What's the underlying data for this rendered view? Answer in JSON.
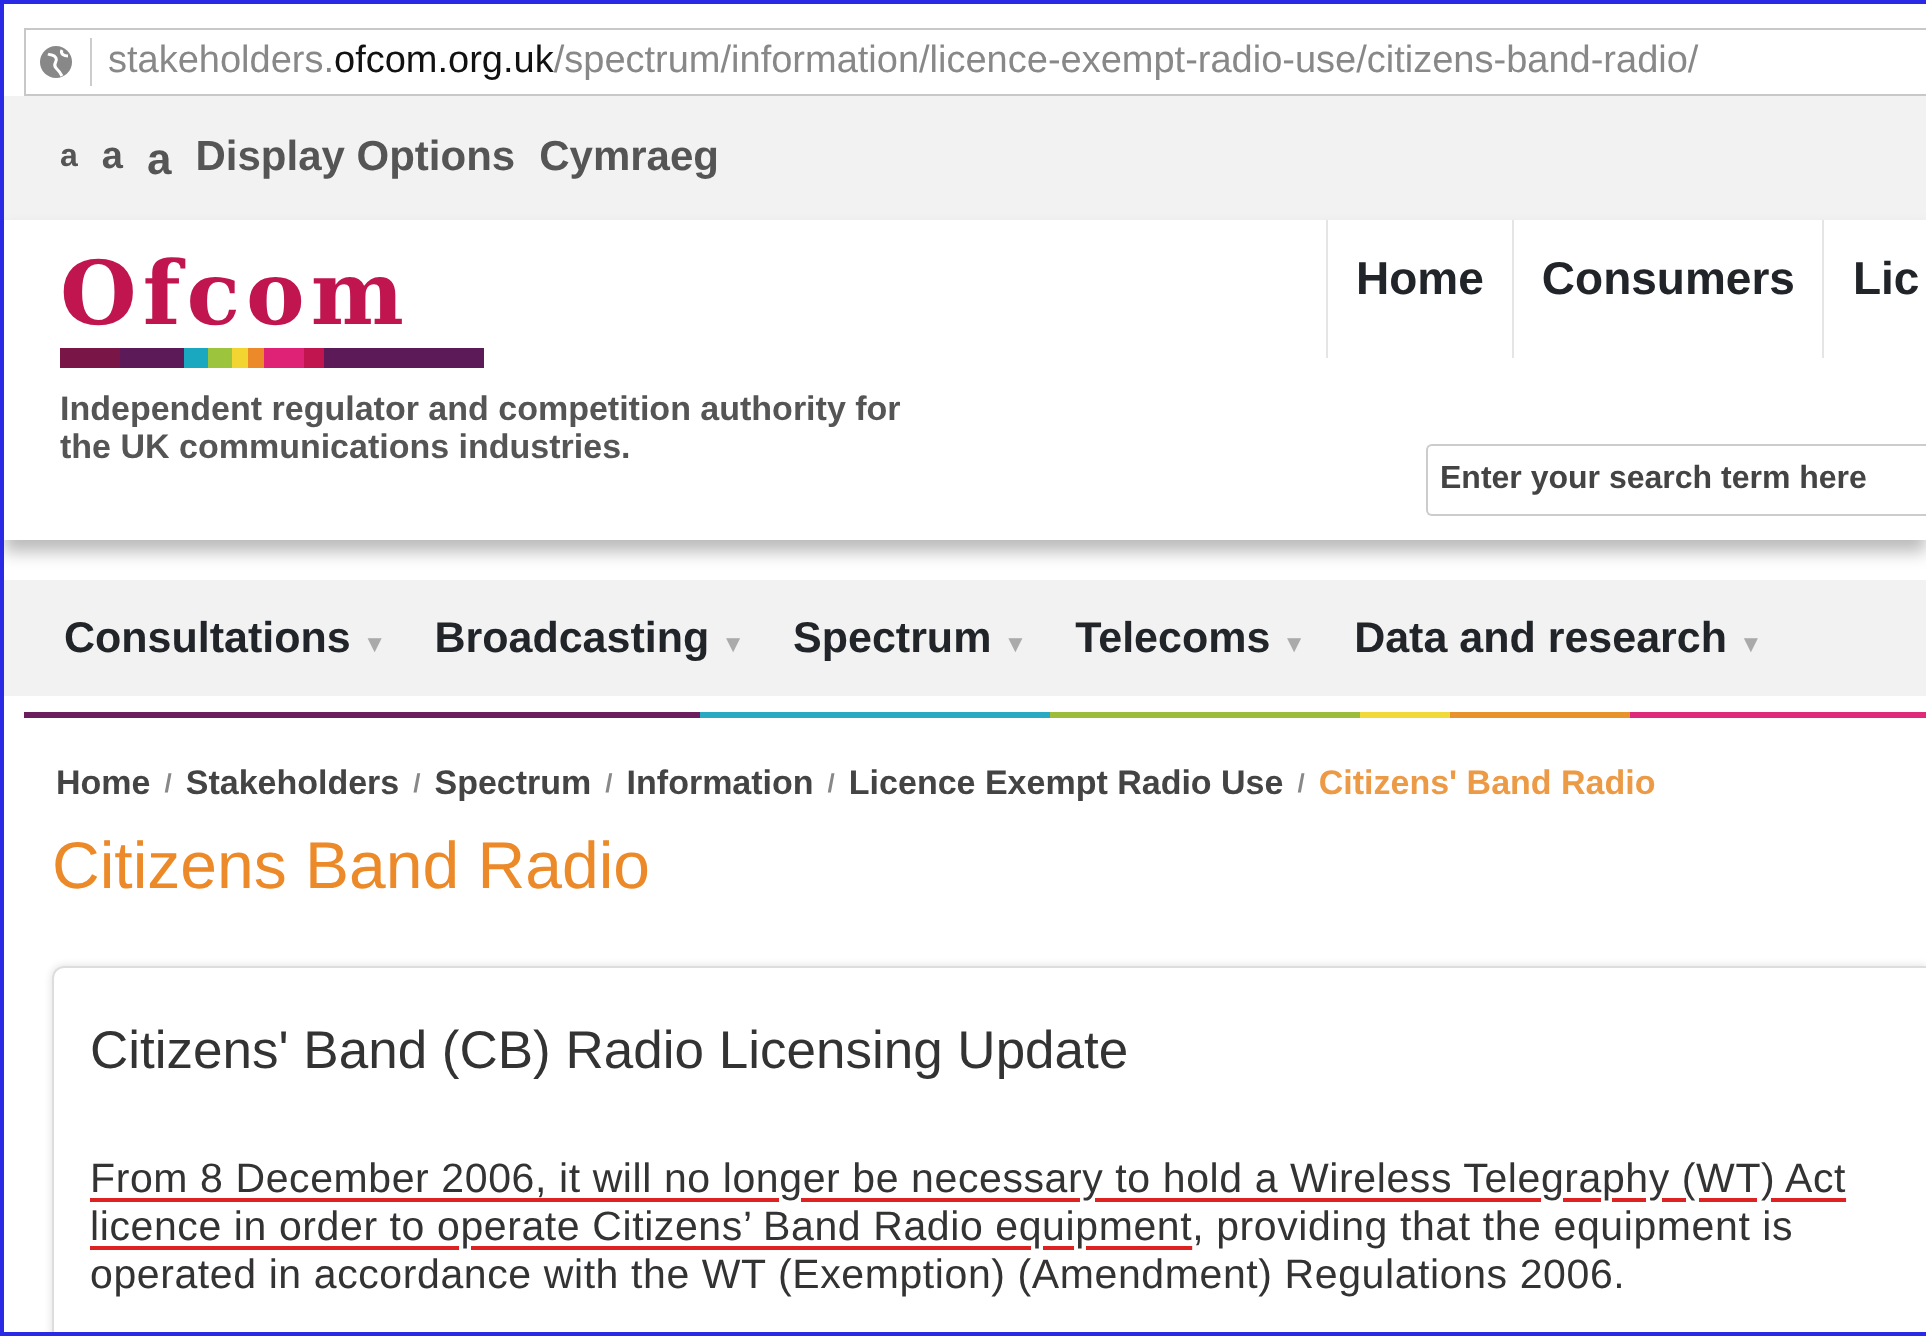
{
  "address_bar": {
    "host_prefix": "stakeholders.",
    "host_main": "ofcom.org.uk",
    "path": "/spectrum/information/licence-exempt-radio-use/citizens-band-radio/"
  },
  "utility_bar": {
    "text_sizes": [
      "a",
      "a",
      "a"
    ],
    "links": [
      "Display Options",
      "Cymraeg"
    ]
  },
  "header": {
    "logo": "Ofcom",
    "tagline": "Independent regulator and competition authority for the UK communications industries.",
    "top_nav": [
      "Home",
      "Consumers",
      "Lic"
    ],
    "search": {
      "placeholder": "Enter your search term here"
    }
  },
  "main_nav": [
    {
      "label": "Consultations",
      "caret": "▼"
    },
    {
      "label": "Broadcasting",
      "caret": "▼"
    },
    {
      "label": "Spectrum",
      "caret": "▼"
    },
    {
      "label": "Telecoms",
      "caret": "▼"
    },
    {
      "label": "Data and research",
      "caret": "▼"
    }
  ],
  "breadcrumb": [
    {
      "label": "Home",
      "current": false
    },
    {
      "separator": "/",
      "label": "Stakeholders",
      "current": false
    },
    {
      "separator": "/",
      "label": "Spectrum",
      "current": false
    },
    {
      "separator": "/",
      "label": "Information",
      "current": false
    },
    {
      "separator": "/",
      "label": "Licence Exempt Radio Use",
      "current": false
    },
    {
      "separator": "/",
      "label": "Citizens' Band Radio",
      "current": true
    }
  ],
  "page_title": "Citizens Band Radio",
  "article": {
    "heading": "Citizens' Band (CB) Radio Licensing Update",
    "paragraph": [
      {
        "text": "From 8 December 2006, it will no longer be necessary to hold a Wireless Telegraphy (WT) Act licence in order to operate Citizens’ Band Radio equipment",
        "underlined": true
      },
      {
        "text": ", providing that the equipment is operated in accordance with the WT (Exemption) (Amendment) Regulations 2006.",
        "underlined": false
      }
    ]
  }
}
